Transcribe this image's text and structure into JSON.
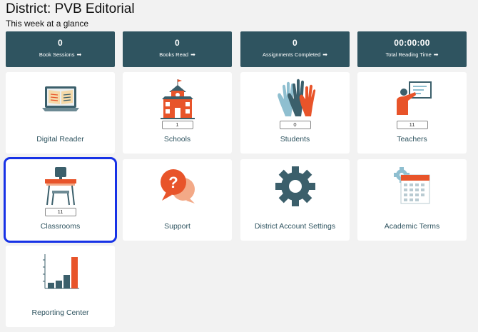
{
  "header": {
    "title": "District: PVB Editorial",
    "subtitle": "This week at a glance"
  },
  "stats": [
    {
      "value": "0",
      "label": "Book Sessions"
    },
    {
      "value": "0",
      "label": "Books Read"
    },
    {
      "value": "0",
      "label": "Assignments Completed"
    },
    {
      "value": "00:00:00",
      "label": "Total Reading Time"
    }
  ],
  "tiles": [
    {
      "name": "Digital Reader",
      "icon": "digital-reader-icon"
    },
    {
      "name": "Schools",
      "count": "1",
      "icon": "school-icon"
    },
    {
      "name": "Students",
      "count": "0",
      "icon": "raised-hands-icon"
    },
    {
      "name": "Teachers",
      "count": "11",
      "icon": "teacher-icon"
    },
    {
      "name": "Classrooms",
      "count": "11",
      "icon": "desk-icon",
      "selected": true
    },
    {
      "name": "Support",
      "icon": "question-bubbles-icon"
    },
    {
      "name": "District Account Settings",
      "icon": "gear-icon"
    },
    {
      "name": "Academic Terms",
      "icon": "calendar-icon"
    },
    {
      "name": "Reporting Center",
      "icon": "bar-chart-icon"
    }
  ],
  "colors": {
    "stat_bg": "#2f5460",
    "accent": "#e8542a",
    "selection": "#1732e6"
  }
}
